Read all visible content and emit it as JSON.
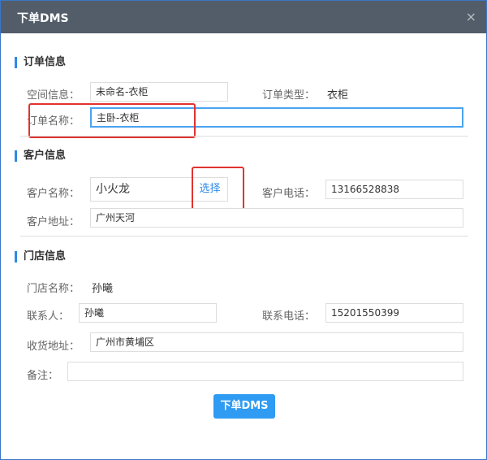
{
  "dialog": {
    "title": "下单DMS",
    "close": "×"
  },
  "order": {
    "section": "订单信息",
    "space_label": "空间信息：",
    "space_value": "未命名-衣柜",
    "type_label": "订单类型：",
    "type_value": "衣柜",
    "name_label": "订单名称：",
    "name_value": "主卧-衣柜"
  },
  "customer": {
    "section": "客户信息",
    "name_label": "客户名称：",
    "name_value": "小火龙",
    "select_label": "选择",
    "phone_label": "客户电话：",
    "phone_value": "13166528838",
    "address_label": "客户地址：",
    "address_value": "广州天河"
  },
  "store": {
    "section": "门店信息",
    "store_name_label": "门店名称：",
    "store_name_value": "孙曦",
    "contact_label": "联系人：",
    "contact_value": "孙曦",
    "contact_phone_label": "联系电话：",
    "contact_phone_value": "15201550399",
    "ship_address_label": "收货地址：",
    "ship_address_value": "广州市黄埔区",
    "note_label": "备注：",
    "note_value": ""
  },
  "submit_label": "下单DMS"
}
